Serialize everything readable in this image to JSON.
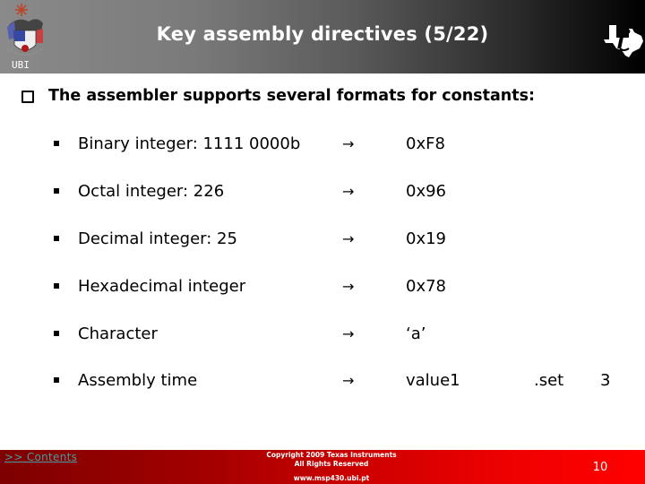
{
  "header": {
    "title": "Key assembly directives (5/22)",
    "logo_left_label": "UBI",
    "logo_left_icon": "ubi-crest-icon",
    "logo_right_icon": "texas-instruments-logo-icon"
  },
  "main_point": {
    "icon": "checkbox-bullet-icon",
    "text": "The assembler supports several formats for constants:"
  },
  "items": [
    {
      "label": "Binary integer: 1111 0000b",
      "arrow": "→",
      "value": "0xF8"
    },
    {
      "label": "Octal integer: 226",
      "arrow": "→",
      "value": "0x96"
    },
    {
      "label": "Decimal integer: 25",
      "arrow": "→",
      "value": "0x19"
    },
    {
      "label": "Hexadecimal integer",
      "arrow": "→",
      "value": "0x78"
    },
    {
      "label": "Character",
      "arrow": "→",
      "value": "‘a’"
    },
    {
      "label": "Assembly time",
      "arrow": "→",
      "value": "value1",
      "directive": ".set",
      "operand": "3"
    }
  ],
  "footer": {
    "contents_link": ">> Contents",
    "copyright_line1": "Copyright  2009 Texas Instruments",
    "copyright_line2": "All Rights Reserved",
    "website": "www.msp430.ubi.pt",
    "page_number": "10"
  },
  "colors": {
    "header_gradient_start": "#8a8a8a",
    "header_gradient_end": "#000000",
    "footer_gradient_start": "#7e0000",
    "footer_gradient_end": "#ff0000",
    "link_color": "#4a9aa0"
  }
}
